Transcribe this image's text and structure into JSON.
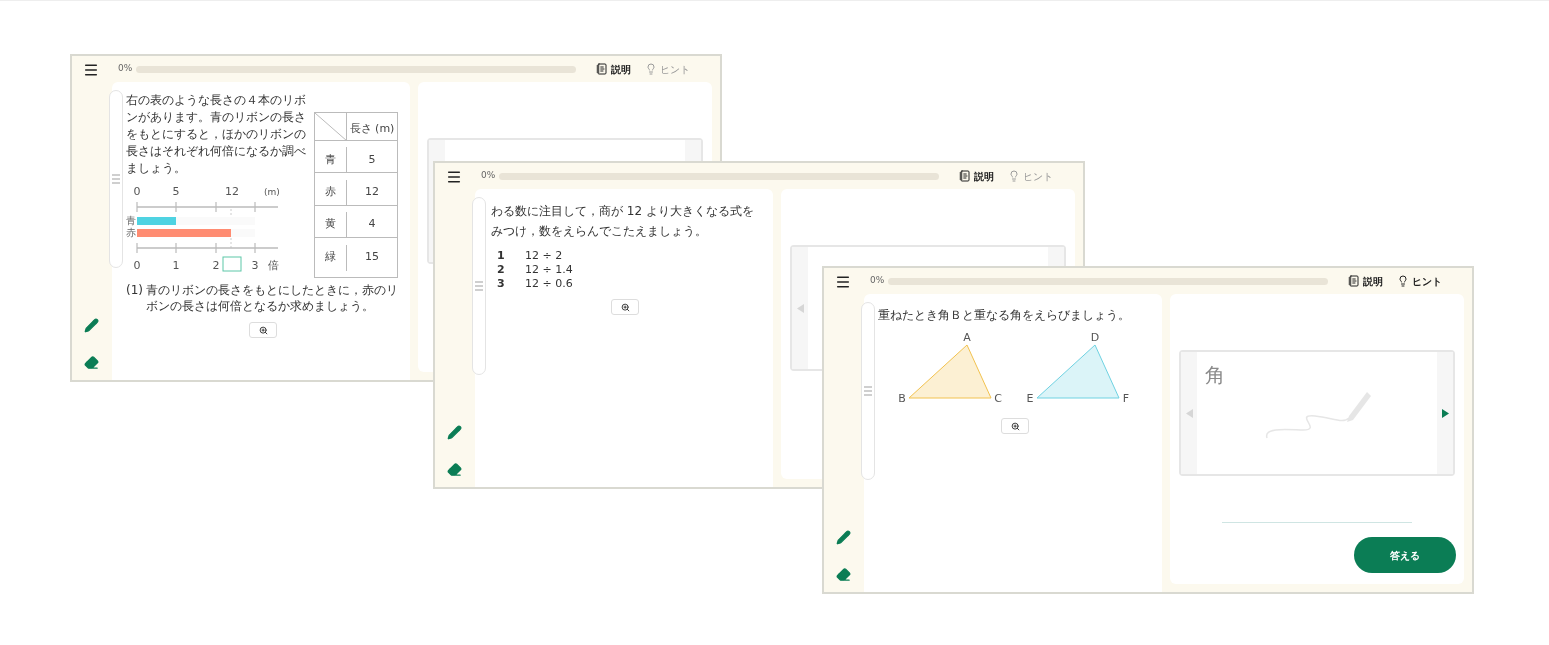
{
  "screens": [
    {
      "progress": {
        "label": "0%",
        "level": 0
      },
      "toolbar": [
        {
          "kind": "explain",
          "label": "説明",
          "disabled": false
        },
        {
          "kind": "hint",
          "label": "ヒント",
          "disabled": true
        }
      ],
      "question": {
        "kind": "ribbons",
        "text": "右の表のような長さの４本のリボンがあります。青のリボンの長さをもとにすると，ほかのリボンの長さはそれぞれ何倍になるか調べましょう。",
        "figure": {
          "top_labels": [
            "0",
            "5",
            "12",
            "(m)"
          ],
          "bottom_labels": [
            "0",
            "1",
            "2",
            "3",
            "倍"
          ],
          "bars": [
            {
              "label": "青",
              "level": 0.333,
              "color": "#4fd3e2"
            },
            {
              "label": "赤",
              "level": 0.8,
              "color": "#ff8c72"
            }
          ]
        },
        "table": {
          "header": "長さ (m)",
          "rows": [
            {
              "name": "青",
              "value": "5"
            },
            {
              "name": "赤",
              "value": "12"
            },
            {
              "name": "黄",
              "value": "4"
            },
            {
              "name": "緑",
              "value": "15"
            }
          ]
        },
        "sub_question": {
          "number": "(1)",
          "text": "青のリボンの長さをもとにしたときに，赤のリボンの長さは何倍となるか求めましょう。"
        }
      }
    },
    {
      "progress": {
        "label": "0%",
        "level": 0
      },
      "toolbar": [
        {
          "kind": "explain",
          "label": "説明",
          "disabled": false
        },
        {
          "kind": "hint",
          "label": "ヒント",
          "disabled": true
        }
      ],
      "question": {
        "kind": "choices",
        "text": "わる数に注目して，商が 12 より大きくなる式をみつけ，数をえらんでこたえましょう。",
        "choices": [
          {
            "number": "1",
            "expression": "12 ÷ 2"
          },
          {
            "number": "2",
            "expression": "12 ÷ 1.4"
          },
          {
            "number": "3",
            "expression": "12 ÷ 0.6"
          }
        ]
      },
      "answer": {
        "board": {
          "arrows": [
            {
              "kind": "prev",
              "disabled": true
            }
          ]
        }
      }
    },
    {
      "progress": {
        "label": "0%",
        "level": 0
      },
      "toolbar": [
        {
          "kind": "explain",
          "label": "説明",
          "disabled": false
        },
        {
          "kind": "hint",
          "label": "ヒント",
          "disabled": false
        }
      ],
      "question": {
        "kind": "triangles",
        "text": "重ねたとき角Ｂと重なる角をえらびましょう。",
        "triangles": [
          {
            "vertices": [
              "A",
              "B",
              "C"
            ],
            "color": "#f2c24f"
          },
          {
            "vertices": [
              "D",
              "E",
              "F"
            ],
            "color": "#6fd2e2"
          }
        ]
      },
      "answer": {
        "board": {
          "character": "角",
          "arrows": [
            {
              "kind": "prev",
              "disabled": true
            },
            {
              "kind": "next",
              "disabled": false
            }
          ]
        },
        "submit": "答える"
      }
    }
  ]
}
